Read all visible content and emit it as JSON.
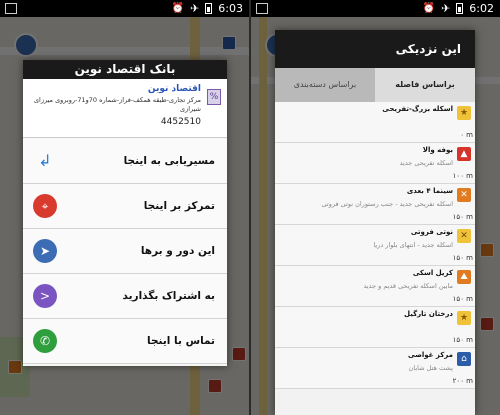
{
  "left_screen": {
    "status": {
      "time": "6:03"
    },
    "dialog": {
      "title": "بانک اقتصاد نوین",
      "info": {
        "name": "اقتصاد نوین",
        "address": "مرکز تجاری-طبقه همکف-فراز-شماره 70و71-روبروی میرزای شیرازی",
        "phone": "4452510"
      },
      "actions": [
        {
          "label": "مسیریابی به اینجا",
          "icon": "route-arrow-icon"
        },
        {
          "label": "تمرکز بر اینجا",
          "icon": "crosshair-icon"
        },
        {
          "label": "این دور و برها",
          "icon": "nearby-compass-icon"
        },
        {
          "label": "به اشتراک بگذارید",
          "icon": "share-icon"
        },
        {
          "label": "تماس با اینجا",
          "icon": "phone-call-icon"
        }
      ]
    }
  },
  "right_screen": {
    "status": {
      "time": "6:02"
    },
    "panel": {
      "title": "این نزدیکی",
      "tabs": [
        {
          "label": "براساس دسته‌بندی",
          "active": false
        },
        {
          "label": "براساس فاصله",
          "active": true
        }
      ],
      "items": [
        {
          "name": "اسکله بزرگ-تفریحی",
          "desc": "",
          "distance": "۰ m",
          "category": "star-icon"
        },
        {
          "name": "بوفه والا",
          "desc": "اسکله تفریحی جدید",
          "distance": "۱۰۰ m",
          "category": "food-icon"
        },
        {
          "name": "سینما ۴ بعدی",
          "desc": "اسکله تفریحی جدید - جنب رستوران نوتی فروتی",
          "distance": "۱۵۰ m",
          "category": "cinema-icon"
        },
        {
          "name": "نوتی فروتی",
          "desc": "اسکله جدید - انتهای بلوار دریا",
          "distance": "۱۵۰ m",
          "category": "restaurant-icon"
        },
        {
          "name": "کریل اسکی",
          "desc": "مابین اسکله تفریحی قدیم و جدید",
          "distance": "۱۵۰ m",
          "category": "rock-icon"
        },
        {
          "name": "درختان تارگیل",
          "desc": "",
          "distance": "۱۵۰ m",
          "category": "star-icon"
        },
        {
          "name": "مرکز غواصی",
          "desc": "پشت هتل شایان",
          "distance": "۲۰۰ m",
          "category": "hotel-icon"
        }
      ]
    }
  },
  "colors": {
    "title_bar": "#1a1a1a",
    "link_blue": "#2a55b8",
    "center_red": "#d93a2e",
    "share_purple": "#7a55c2",
    "call_green": "#2f9e3d"
  }
}
